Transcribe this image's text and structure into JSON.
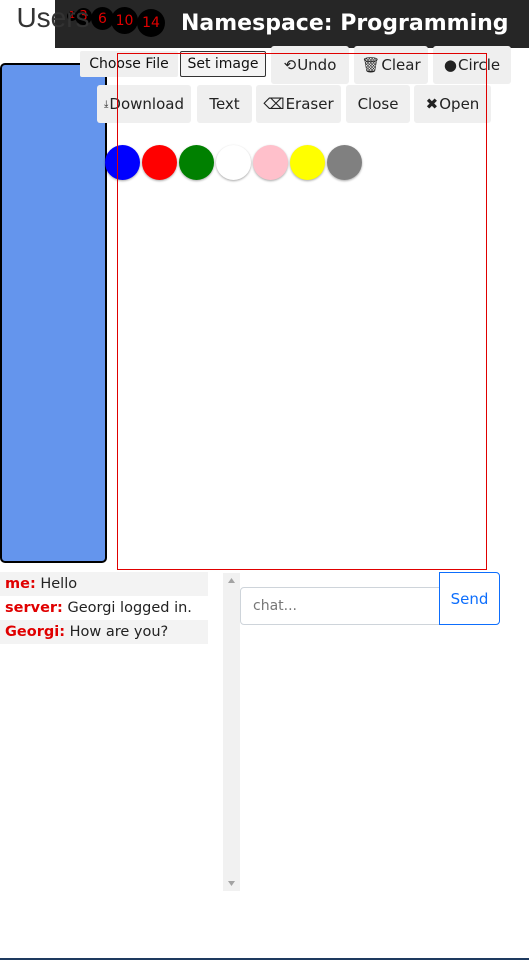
{
  "header": {
    "title": "Namespace: Programming",
    "brush_sizes": [
      "1",
      "3",
      "6",
      "10",
      "14"
    ]
  },
  "users_panel": {
    "title": "Users"
  },
  "toolbar": {
    "choose_file": "Choose File",
    "set_image": "Set image",
    "undo": "Undo",
    "clear": "Clear",
    "circle": "Circle",
    "download": "Download",
    "text": "Text",
    "eraser": "Eraser",
    "close": "Close",
    "open": "Open"
  },
  "palette": {
    "colors": [
      "#0000ff",
      "#ff0000",
      "#008000",
      "#ffffff",
      "#ffc0cb",
      "#ffff00",
      "#808080"
    ]
  },
  "chat": {
    "messages": [
      {
        "user": "me:",
        "text": "Hello"
      },
      {
        "user": "server:",
        "text": "Georgi logged in."
      },
      {
        "user": "Georgi:",
        "text": "How are you?"
      }
    ],
    "input_placeholder": "chat...",
    "send_label": "Send"
  },
  "colors": {
    "user_name": "#e00000",
    "accent": "#0d6efd",
    "users_panel_bg": "#6495ed"
  }
}
